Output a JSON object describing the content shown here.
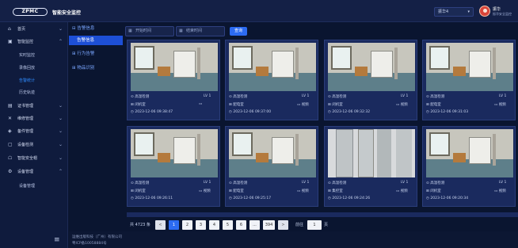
{
  "header": {
    "logo_text": "ZPMC",
    "app_title": "智能安全监控",
    "select_value": "振华4",
    "user_name": "振华",
    "user_org": "振华安全监控"
  },
  "sidebar": {
    "items": [
      {
        "label": "首页",
        "icon": "home-icon"
      },
      {
        "label": "智能监控",
        "icon": "monitor-icon"
      },
      {
        "label": "证书管理",
        "icon": "certificate-icon"
      },
      {
        "label": "维修管理",
        "icon": "wrench-icon"
      },
      {
        "label": "备件管理",
        "icon": "box-icon"
      },
      {
        "label": "设备检测",
        "icon": "device-check-icon"
      },
      {
        "label": "智能安全帽",
        "icon": "helmet-icon"
      },
      {
        "label": "设备管理",
        "icon": "gear-icon"
      }
    ],
    "monitor_subitems": [
      "实时监控",
      "录像回放",
      "告警统计",
      "历史轨迹"
    ],
    "device_subitems": [
      "设备管理"
    ]
  },
  "subnav": {
    "group1": "告警信息",
    "active": "告警信息",
    "group2": "行为告警",
    "group3": "物品识别"
  },
  "filters": {
    "start_placeholder": "开始时间",
    "end_placeholder": "结束时间",
    "search_label": "查询"
  },
  "cards": [
    {
      "type": "高温检测",
      "level": "LV 1",
      "location": "闭机室",
      "video_label": "",
      "time": "2023-12-06 09:38:47"
    },
    {
      "type": "高温检测",
      "level": "LV 1",
      "location": "配电室",
      "video_label": "视频",
      "time": "2023-12-06 09:37:00"
    },
    {
      "type": "高温检测",
      "level": "LV 1",
      "location": "闭机室",
      "video_label": "视频",
      "time": "2023-12-06 09:32:32"
    },
    {
      "type": "高温检测",
      "level": "LV 1",
      "location": "配电室",
      "video_label": "视频",
      "time": "2023-12-06 09:31:03"
    },
    {
      "type": "高温检测",
      "level": "LV 1",
      "location": "闭机室",
      "video_label": "视频",
      "time": "2023-12-06 09:26:11"
    },
    {
      "type": "高温检测",
      "level": "LV 1",
      "location": "配电室",
      "video_label": "视频",
      "time": "2023-12-06 09:25:17"
    },
    {
      "type": "高温检测",
      "level": "LV 1",
      "location": "集控室",
      "video_label": "视频",
      "time": "2023-12-06 09:24:26"
    },
    {
      "type": "高温检测",
      "level": "LV 1",
      "location": "闭机室",
      "video_label": "视频",
      "time": "2023-12-06 09:20:34"
    }
  ],
  "pagination": {
    "total": "共 4723 条",
    "pages": [
      "1",
      "2",
      "3",
      "4",
      "5",
      "6",
      "...",
      "394"
    ],
    "prev": "<",
    "next": ">",
    "goto_label": "前往",
    "goto_value": "1",
    "goto_suffix": "页"
  },
  "footer": {
    "line1": "运维出版科技（广州）有限公司",
    "line2": "粤ICP备10058884号"
  }
}
